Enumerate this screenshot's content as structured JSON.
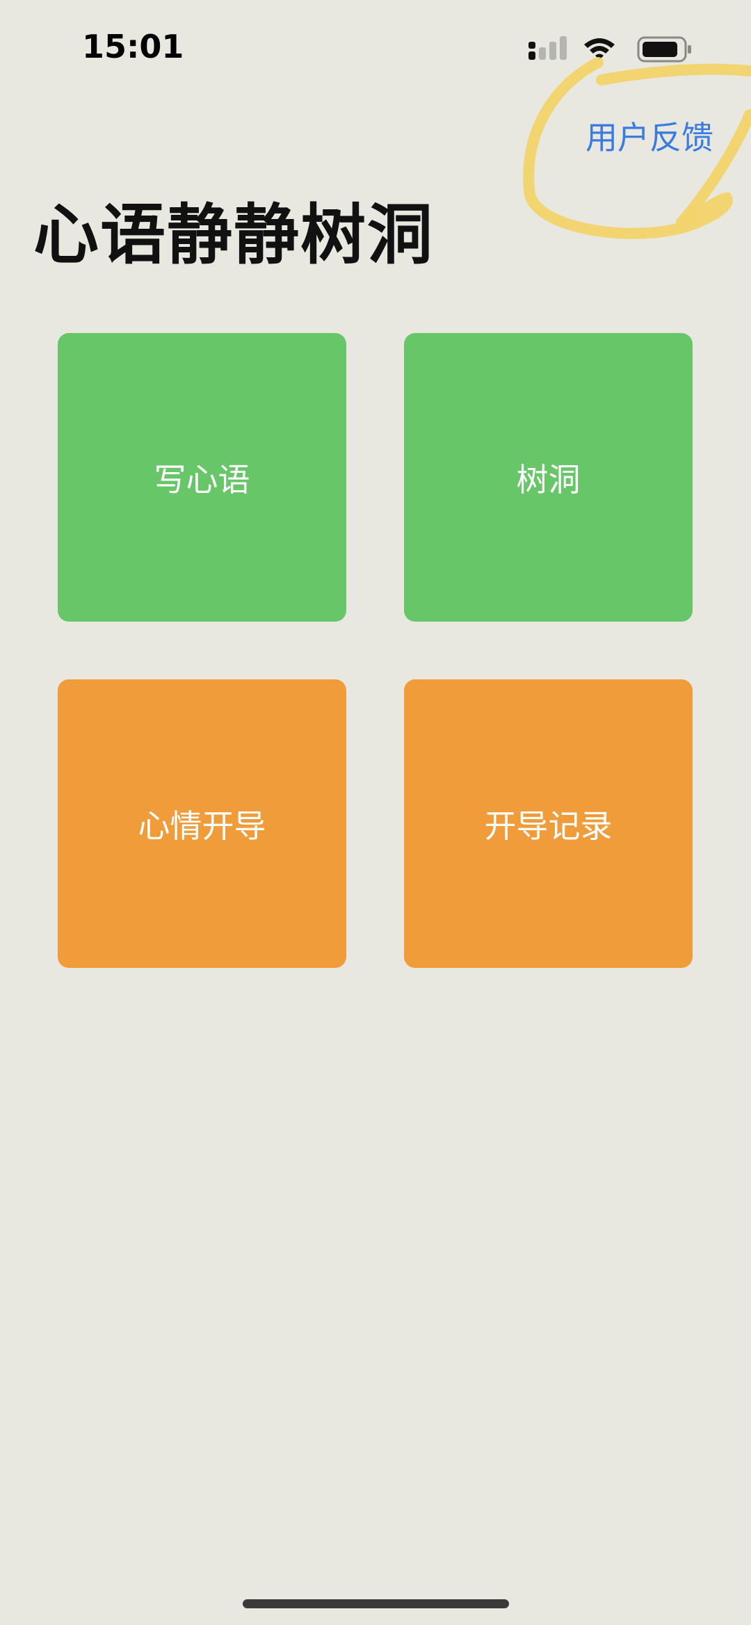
{
  "status_bar": {
    "time": "15:01",
    "icons": [
      "cellular-signal-icon",
      "wifi-icon",
      "battery-icon"
    ]
  },
  "header": {
    "feedback_label": "用户反馈",
    "title": "心语静静树洞"
  },
  "tiles": [
    {
      "label": "写心语",
      "color": "#67C668"
    },
    {
      "label": "树洞",
      "color": "#67C668"
    },
    {
      "label": "心情开导",
      "color": "#F09C3A"
    },
    {
      "label": "开导记录",
      "color": "#F09C3A"
    }
  ],
  "colors": {
    "background": "#E8E8E1",
    "link": "#3A7BE0",
    "highlight": "#F2D469"
  }
}
